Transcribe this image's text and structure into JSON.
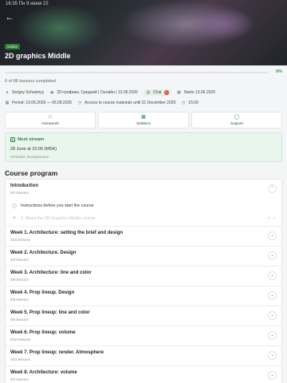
{
  "status_bar": {
    "time": "16:35 Пн 9 июня 22"
  },
  "hero": {
    "badge": "Online",
    "title": "2D graphics Middle"
  },
  "progress": {
    "percent_label": "0%",
    "fraction": 0.0,
    "lessons_done": "0 of 86 lessons completed"
  },
  "meta": {
    "author": "Sergey Schastnyy",
    "group": "2D-графика. Средний | Онлайн | 13.06.2026",
    "chat_label": "Chat",
    "chat_count": "2",
    "starts": "Starts 13.06.2026",
    "period": "Period: 13.06.2026 — 05.09.2026",
    "access": "Access to course materials until 31 December 2029",
    "time": "15:00"
  },
  "tabs": [
    {
      "label": "Homework",
      "icon": "homework-icon"
    },
    {
      "label": "Statistics",
      "icon": "statistics-icon"
    },
    {
      "label": "Support",
      "icon": "support-icon"
    }
  ],
  "next_stream": {
    "title": "Next stream",
    "time": "28 June at 15:00 (MSK)",
    "schedule": "Schedule: Воскресенье"
  },
  "course_program": {
    "title": "Course program",
    "intro": {
      "title": "Introduction",
      "sub": "0/2 lessons",
      "lessons": [
        {
          "title": "Instructions before you start the course"
        },
        {
          "title": "2. About the 2D Graphics Middle course",
          "right": "0 · 0"
        }
      ]
    },
    "modules": [
      {
        "title": "Week 1. Architecture: setting the brief and design",
        "sub": "0/15 lessons"
      },
      {
        "title": "Week 2. Architecture. Design",
        "sub": "0/4 lessons"
      },
      {
        "title": "Week 3. Architecture: line and color",
        "sub": "0/8 lessons"
      },
      {
        "title": "Week 4. Prop lineup. Design",
        "sub": "0/5 lessons"
      },
      {
        "title": "Week 5. Prop lineup: line and color",
        "sub": "0/5 lessons"
      },
      {
        "title": "Week 6. Prop lineup: volume",
        "sub": "0/10 lessons"
      },
      {
        "title": "Week 7. Prop lineup: render. Atmosphere",
        "sub": "0/11 lessons"
      },
      {
        "title": "Week 8. Architecture: volume",
        "sub": "0/4 lessons"
      }
    ]
  }
}
